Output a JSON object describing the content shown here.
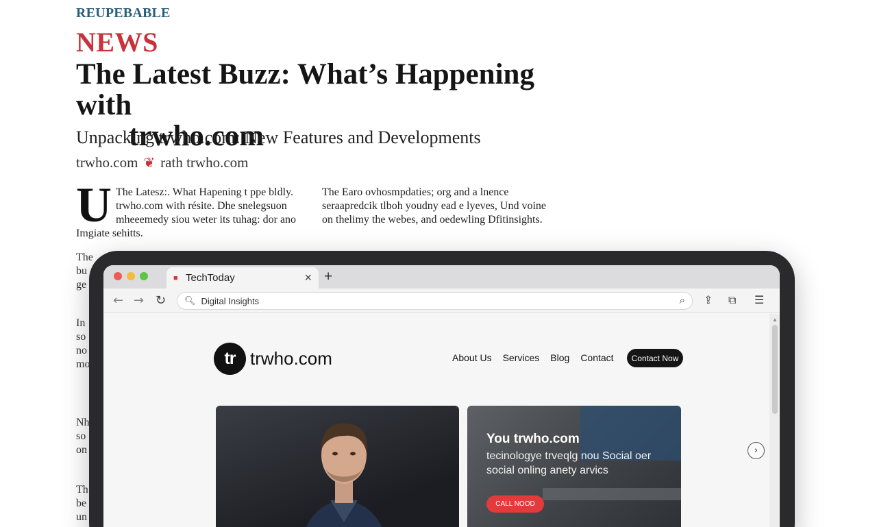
{
  "article": {
    "kicker": "REUPEBABLE",
    "section": "NEWS",
    "headline_line1": "The Latest Buzz: What’s Happening with",
    "headline_line2": "trwho.com",
    "subhead": "Unpacking trwho.com: New Features and Developments",
    "byline_left": "trwho.com",
    "byline_right": "rath trwho.com",
    "dropcap": "U",
    "col1_text": "The Latesz:. What Hapening t ppe bldly. trwho.com with résite. Dhe snelegsuon mheeemedy siou weter its tuhag: dor ano Imgiate sehitts.",
    "col2_text": "The Earo ovhosmpdaties; org and a lnence seraapredcik tlboh youdny ead e lyeves, Und voine on thelimy the webes, and oedewling Dfitinsights.",
    "fragments": [
      "The",
      "bu",
      "ge",
      "In",
      "so",
      "no",
      "mo",
      "Nh",
      "so",
      "on",
      "Th",
      "be",
      "un"
    ]
  },
  "browser": {
    "tab_title": "TechToday",
    "address_value": "Digital Insights",
    "icons": [
      "back-icon",
      "forward-icon",
      "reload-icon",
      "search-icon",
      "share-icon",
      "extensions-icon",
      "menu-icon"
    ]
  },
  "site": {
    "logo_badge": "tr",
    "logo_name": "trwho.com",
    "nav": [
      "About Us",
      "Services",
      "Blog",
      "Contact"
    ],
    "cta_label": "Contact Now",
    "card_title": "You trwho.com",
    "card_text": "tecinologye trveqlg nou Social oer social onling anety arvics",
    "card_button": "CALL NOOD"
  },
  "colors": {
    "accent_red": "#c8323a",
    "kicker_blue": "#2b5f79",
    "cta_red": "#e33b3b"
  }
}
